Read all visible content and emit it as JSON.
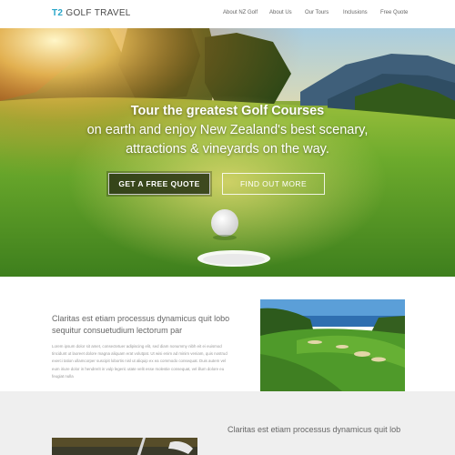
{
  "header": {
    "logo_mark": "T2",
    "logo_text": "GOLF TRAVEL",
    "nav": [
      {
        "label": "About NZ Golf"
      },
      {
        "label": "About Us"
      },
      {
        "label": "Our Tours"
      },
      {
        "label": "Inclusions"
      },
      {
        "label": "Free Quote"
      }
    ]
  },
  "hero": {
    "title": "Tour the greatest Golf Courses",
    "subtitle_line1": "on earth and enjoy New Zealand's best scenary,",
    "subtitle_line2": "attractions & vineyards on the way.",
    "primary_button": "GET A FREE QUOTE",
    "secondary_button": "FIND OUT MORE"
  },
  "intro": {
    "heading": "Claritas est etiam processus dynamicus quit lobo sequitur consuetudium lectorum par",
    "body": "Lorem ipsum dolor sit amet, consectetuer adipiscing elit, sed diam nonummy nibh eit ei euismod tincidunt ut laoreet dolore magna aliquam erat volutpat. Ut wisi enim ad minim veniam, quis nostrud exerci tation ullamcorper suscipit lobortis nisl ut aliquip ex ea commodo consequat. Duis autem vel eum iriure dolor in hendrerit in vulp legeric utate velit esse molestie consequat, vel illum dolore eu feugiat nulla"
  },
  "bottom": {
    "text": "Claritas est etiam processus dynamicus quit lob"
  },
  "colors": {
    "brand_accent": "#2aa6c9",
    "bottom_bg": "#efefef"
  }
}
